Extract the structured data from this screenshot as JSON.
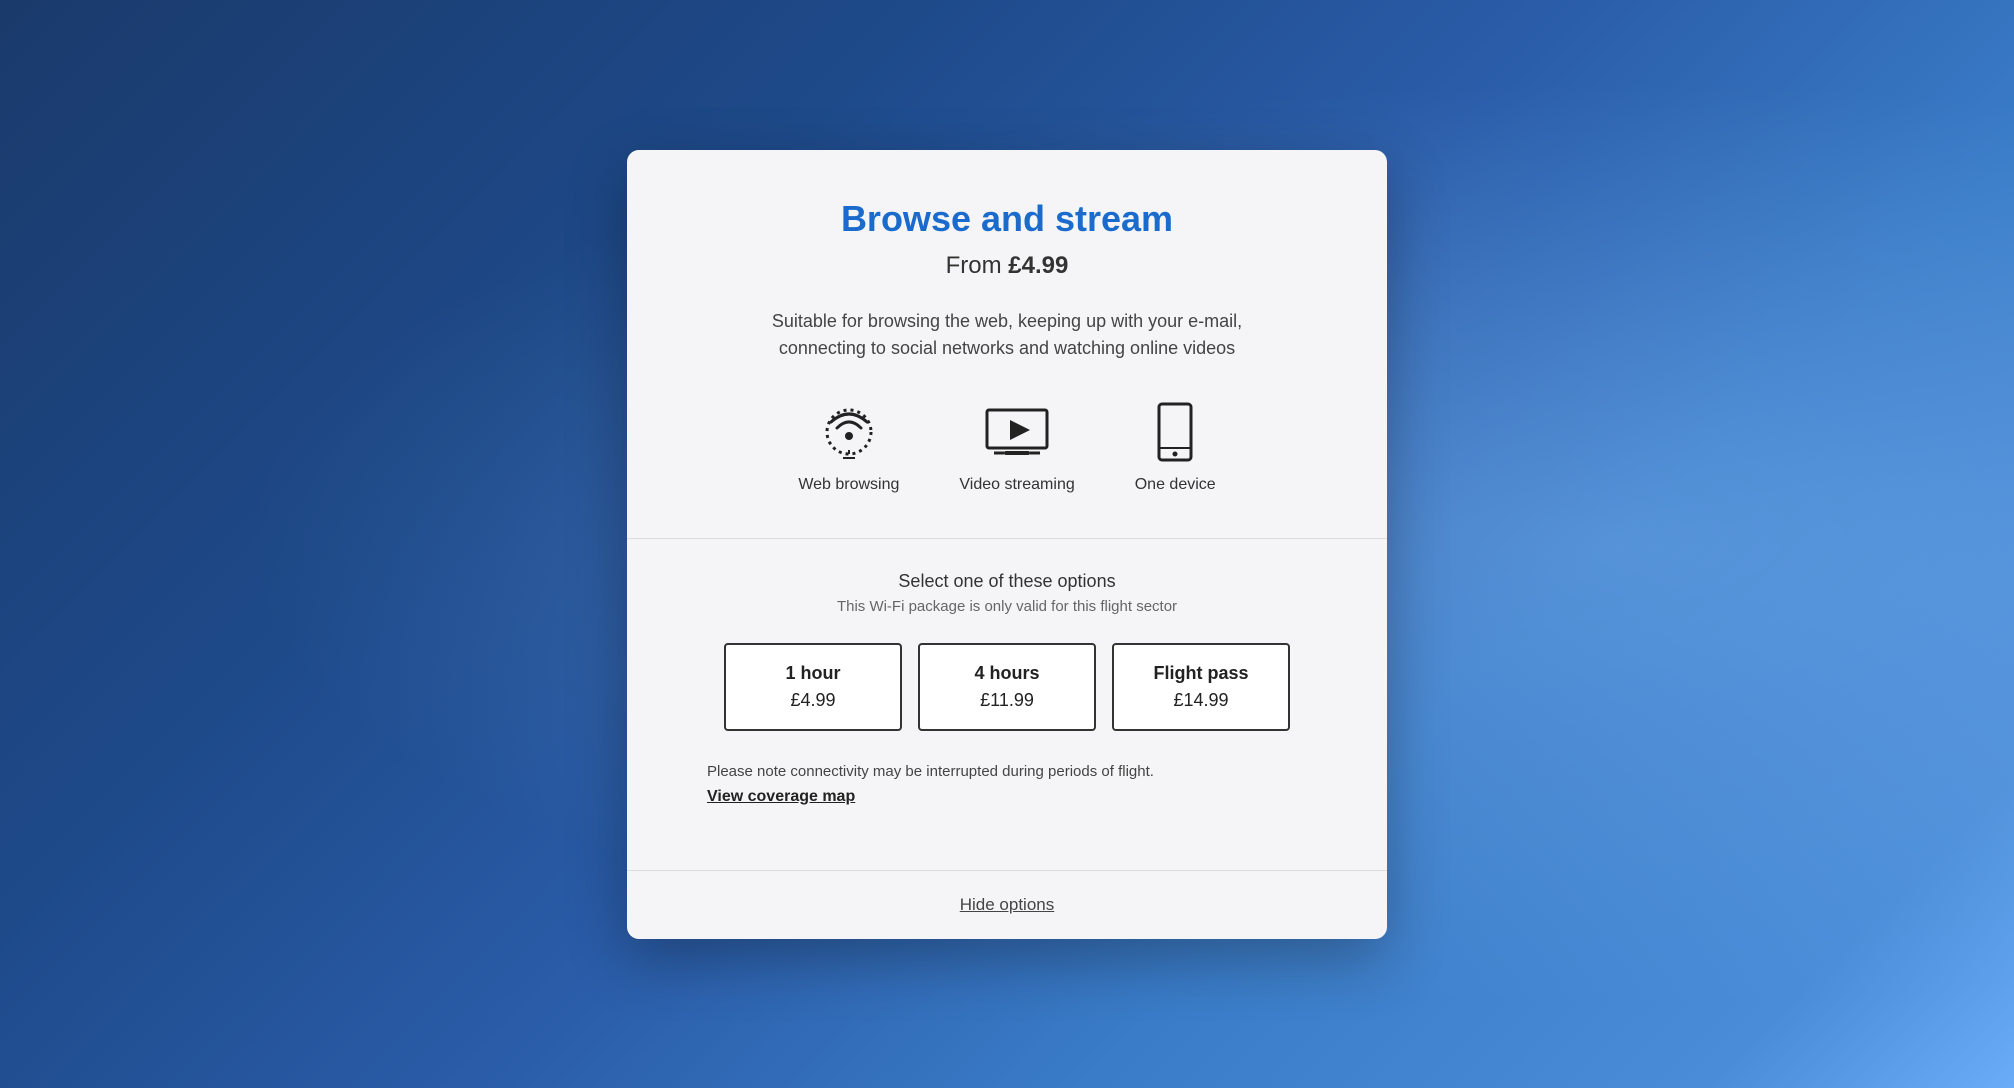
{
  "background": {
    "gradient_start": "#1a3a6b",
    "gradient_end": "#6aacf8"
  },
  "modal": {
    "title": "Browse and stream",
    "price_label": "From ",
    "price_value": "£4.99",
    "description": "Suitable for browsing the web, keeping up with your e-mail, connecting to social networks and watching online videos",
    "features": [
      {
        "id": "web-browsing",
        "label": "Web browsing",
        "icon": "wifi-icon"
      },
      {
        "id": "video-streaming",
        "label": "Video streaming",
        "icon": "play-icon"
      },
      {
        "id": "one-device",
        "label": "One device",
        "icon": "mobile-icon"
      }
    ],
    "options_title": "Select one of these options",
    "options_subtitle": "This Wi-Fi package is only valid for this flight sector",
    "packages": [
      {
        "id": "1hour",
        "title": "1 hour",
        "price": "£4.99"
      },
      {
        "id": "4hours",
        "title": "4 hours",
        "price": "£11.99"
      },
      {
        "id": "flight-pass",
        "title": "Flight pass",
        "price": "£14.99"
      }
    ],
    "connectivity_note": "Please note connectivity may be interrupted during periods of flight.",
    "coverage_map_link": "View coverage map",
    "hide_options_link": "Hide options"
  }
}
